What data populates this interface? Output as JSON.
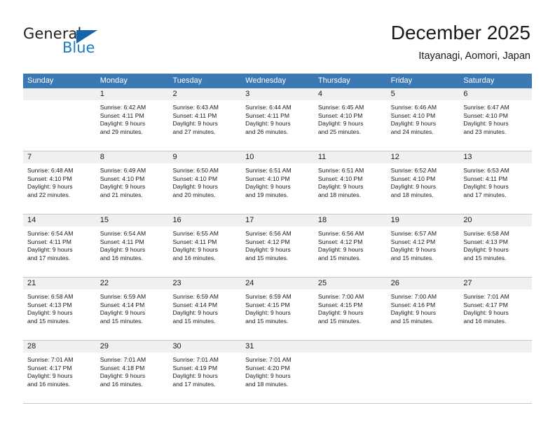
{
  "brand": {
    "name_part1": "General",
    "name_part2": "Blue"
  },
  "header": {
    "title": "December 2025",
    "subtitle": "Itayanagi, Aomori, Japan"
  },
  "colors": {
    "header_blue": "#3b79b5",
    "logo_blue": "#1a7dc4",
    "daynum_band": "#f0f0f0",
    "grid_line": "#c8c8c8"
  },
  "weekdays": [
    "Sunday",
    "Monday",
    "Tuesday",
    "Wednesday",
    "Thursday",
    "Friday",
    "Saturday"
  ],
  "calendar": {
    "weeks": [
      [
        {
          "day": "",
          "sunrise": "",
          "sunset": "",
          "daylight1": "",
          "daylight2": ""
        },
        {
          "day": "1",
          "sunrise": "Sunrise: 6:42 AM",
          "sunset": "Sunset: 4:11 PM",
          "daylight1": "Daylight: 9 hours",
          "daylight2": "and 29 minutes."
        },
        {
          "day": "2",
          "sunrise": "Sunrise: 6:43 AM",
          "sunset": "Sunset: 4:11 PM",
          "daylight1": "Daylight: 9 hours",
          "daylight2": "and 27 minutes."
        },
        {
          "day": "3",
          "sunrise": "Sunrise: 6:44 AM",
          "sunset": "Sunset: 4:11 PM",
          "daylight1": "Daylight: 9 hours",
          "daylight2": "and 26 minutes."
        },
        {
          "day": "4",
          "sunrise": "Sunrise: 6:45 AM",
          "sunset": "Sunset: 4:10 PM",
          "daylight1": "Daylight: 9 hours",
          "daylight2": "and 25 minutes."
        },
        {
          "day": "5",
          "sunrise": "Sunrise: 6:46 AM",
          "sunset": "Sunset: 4:10 PM",
          "daylight1": "Daylight: 9 hours",
          "daylight2": "and 24 minutes."
        },
        {
          "day": "6",
          "sunrise": "Sunrise: 6:47 AM",
          "sunset": "Sunset: 4:10 PM",
          "daylight1": "Daylight: 9 hours",
          "daylight2": "and 23 minutes."
        }
      ],
      [
        {
          "day": "7",
          "sunrise": "Sunrise: 6:48 AM",
          "sunset": "Sunset: 4:10 PM",
          "daylight1": "Daylight: 9 hours",
          "daylight2": "and 22 minutes."
        },
        {
          "day": "8",
          "sunrise": "Sunrise: 6:49 AM",
          "sunset": "Sunset: 4:10 PM",
          "daylight1": "Daylight: 9 hours",
          "daylight2": "and 21 minutes."
        },
        {
          "day": "9",
          "sunrise": "Sunrise: 6:50 AM",
          "sunset": "Sunset: 4:10 PM",
          "daylight1": "Daylight: 9 hours",
          "daylight2": "and 20 minutes."
        },
        {
          "day": "10",
          "sunrise": "Sunrise: 6:51 AM",
          "sunset": "Sunset: 4:10 PM",
          "daylight1": "Daylight: 9 hours",
          "daylight2": "and 19 minutes."
        },
        {
          "day": "11",
          "sunrise": "Sunrise: 6:51 AM",
          "sunset": "Sunset: 4:10 PM",
          "daylight1": "Daylight: 9 hours",
          "daylight2": "and 18 minutes."
        },
        {
          "day": "12",
          "sunrise": "Sunrise: 6:52 AM",
          "sunset": "Sunset: 4:10 PM",
          "daylight1": "Daylight: 9 hours",
          "daylight2": "and 18 minutes."
        },
        {
          "day": "13",
          "sunrise": "Sunrise: 6:53 AM",
          "sunset": "Sunset: 4:11 PM",
          "daylight1": "Daylight: 9 hours",
          "daylight2": "and 17 minutes."
        }
      ],
      [
        {
          "day": "14",
          "sunrise": "Sunrise: 6:54 AM",
          "sunset": "Sunset: 4:11 PM",
          "daylight1": "Daylight: 9 hours",
          "daylight2": "and 17 minutes."
        },
        {
          "day": "15",
          "sunrise": "Sunrise: 6:54 AM",
          "sunset": "Sunset: 4:11 PM",
          "daylight1": "Daylight: 9 hours",
          "daylight2": "and 16 minutes."
        },
        {
          "day": "16",
          "sunrise": "Sunrise: 6:55 AM",
          "sunset": "Sunset: 4:11 PM",
          "daylight1": "Daylight: 9 hours",
          "daylight2": "and 16 minutes."
        },
        {
          "day": "17",
          "sunrise": "Sunrise: 6:56 AM",
          "sunset": "Sunset: 4:12 PM",
          "daylight1": "Daylight: 9 hours",
          "daylight2": "and 15 minutes."
        },
        {
          "day": "18",
          "sunrise": "Sunrise: 6:56 AM",
          "sunset": "Sunset: 4:12 PM",
          "daylight1": "Daylight: 9 hours",
          "daylight2": "and 15 minutes."
        },
        {
          "day": "19",
          "sunrise": "Sunrise: 6:57 AM",
          "sunset": "Sunset: 4:12 PM",
          "daylight1": "Daylight: 9 hours",
          "daylight2": "and 15 minutes."
        },
        {
          "day": "20",
          "sunrise": "Sunrise: 6:58 AM",
          "sunset": "Sunset: 4:13 PM",
          "daylight1": "Daylight: 9 hours",
          "daylight2": "and 15 minutes."
        }
      ],
      [
        {
          "day": "21",
          "sunrise": "Sunrise: 6:58 AM",
          "sunset": "Sunset: 4:13 PM",
          "daylight1": "Daylight: 9 hours",
          "daylight2": "and 15 minutes."
        },
        {
          "day": "22",
          "sunrise": "Sunrise: 6:59 AM",
          "sunset": "Sunset: 4:14 PM",
          "daylight1": "Daylight: 9 hours",
          "daylight2": "and 15 minutes."
        },
        {
          "day": "23",
          "sunrise": "Sunrise: 6:59 AM",
          "sunset": "Sunset: 4:14 PM",
          "daylight1": "Daylight: 9 hours",
          "daylight2": "and 15 minutes."
        },
        {
          "day": "24",
          "sunrise": "Sunrise: 6:59 AM",
          "sunset": "Sunset: 4:15 PM",
          "daylight1": "Daylight: 9 hours",
          "daylight2": "and 15 minutes."
        },
        {
          "day": "25",
          "sunrise": "Sunrise: 7:00 AM",
          "sunset": "Sunset: 4:15 PM",
          "daylight1": "Daylight: 9 hours",
          "daylight2": "and 15 minutes."
        },
        {
          "day": "26",
          "sunrise": "Sunrise: 7:00 AM",
          "sunset": "Sunset: 4:16 PM",
          "daylight1": "Daylight: 9 hours",
          "daylight2": "and 15 minutes."
        },
        {
          "day": "27",
          "sunrise": "Sunrise: 7:01 AM",
          "sunset": "Sunset: 4:17 PM",
          "daylight1": "Daylight: 9 hours",
          "daylight2": "and 16 minutes."
        }
      ],
      [
        {
          "day": "28",
          "sunrise": "Sunrise: 7:01 AM",
          "sunset": "Sunset: 4:17 PM",
          "daylight1": "Daylight: 9 hours",
          "daylight2": "and 16 minutes."
        },
        {
          "day": "29",
          "sunrise": "Sunrise: 7:01 AM",
          "sunset": "Sunset: 4:18 PM",
          "daylight1": "Daylight: 9 hours",
          "daylight2": "and 16 minutes."
        },
        {
          "day": "30",
          "sunrise": "Sunrise: 7:01 AM",
          "sunset": "Sunset: 4:19 PM",
          "daylight1": "Daylight: 9 hours",
          "daylight2": "and 17 minutes."
        },
        {
          "day": "31",
          "sunrise": "Sunrise: 7:01 AM",
          "sunset": "Sunset: 4:20 PM",
          "daylight1": "Daylight: 9 hours",
          "daylight2": "and 18 minutes."
        },
        {
          "day": "",
          "sunrise": "",
          "sunset": "",
          "daylight1": "",
          "daylight2": ""
        },
        {
          "day": "",
          "sunrise": "",
          "sunset": "",
          "daylight1": "",
          "daylight2": ""
        },
        {
          "day": "",
          "sunrise": "",
          "sunset": "",
          "daylight1": "",
          "daylight2": ""
        }
      ]
    ]
  }
}
